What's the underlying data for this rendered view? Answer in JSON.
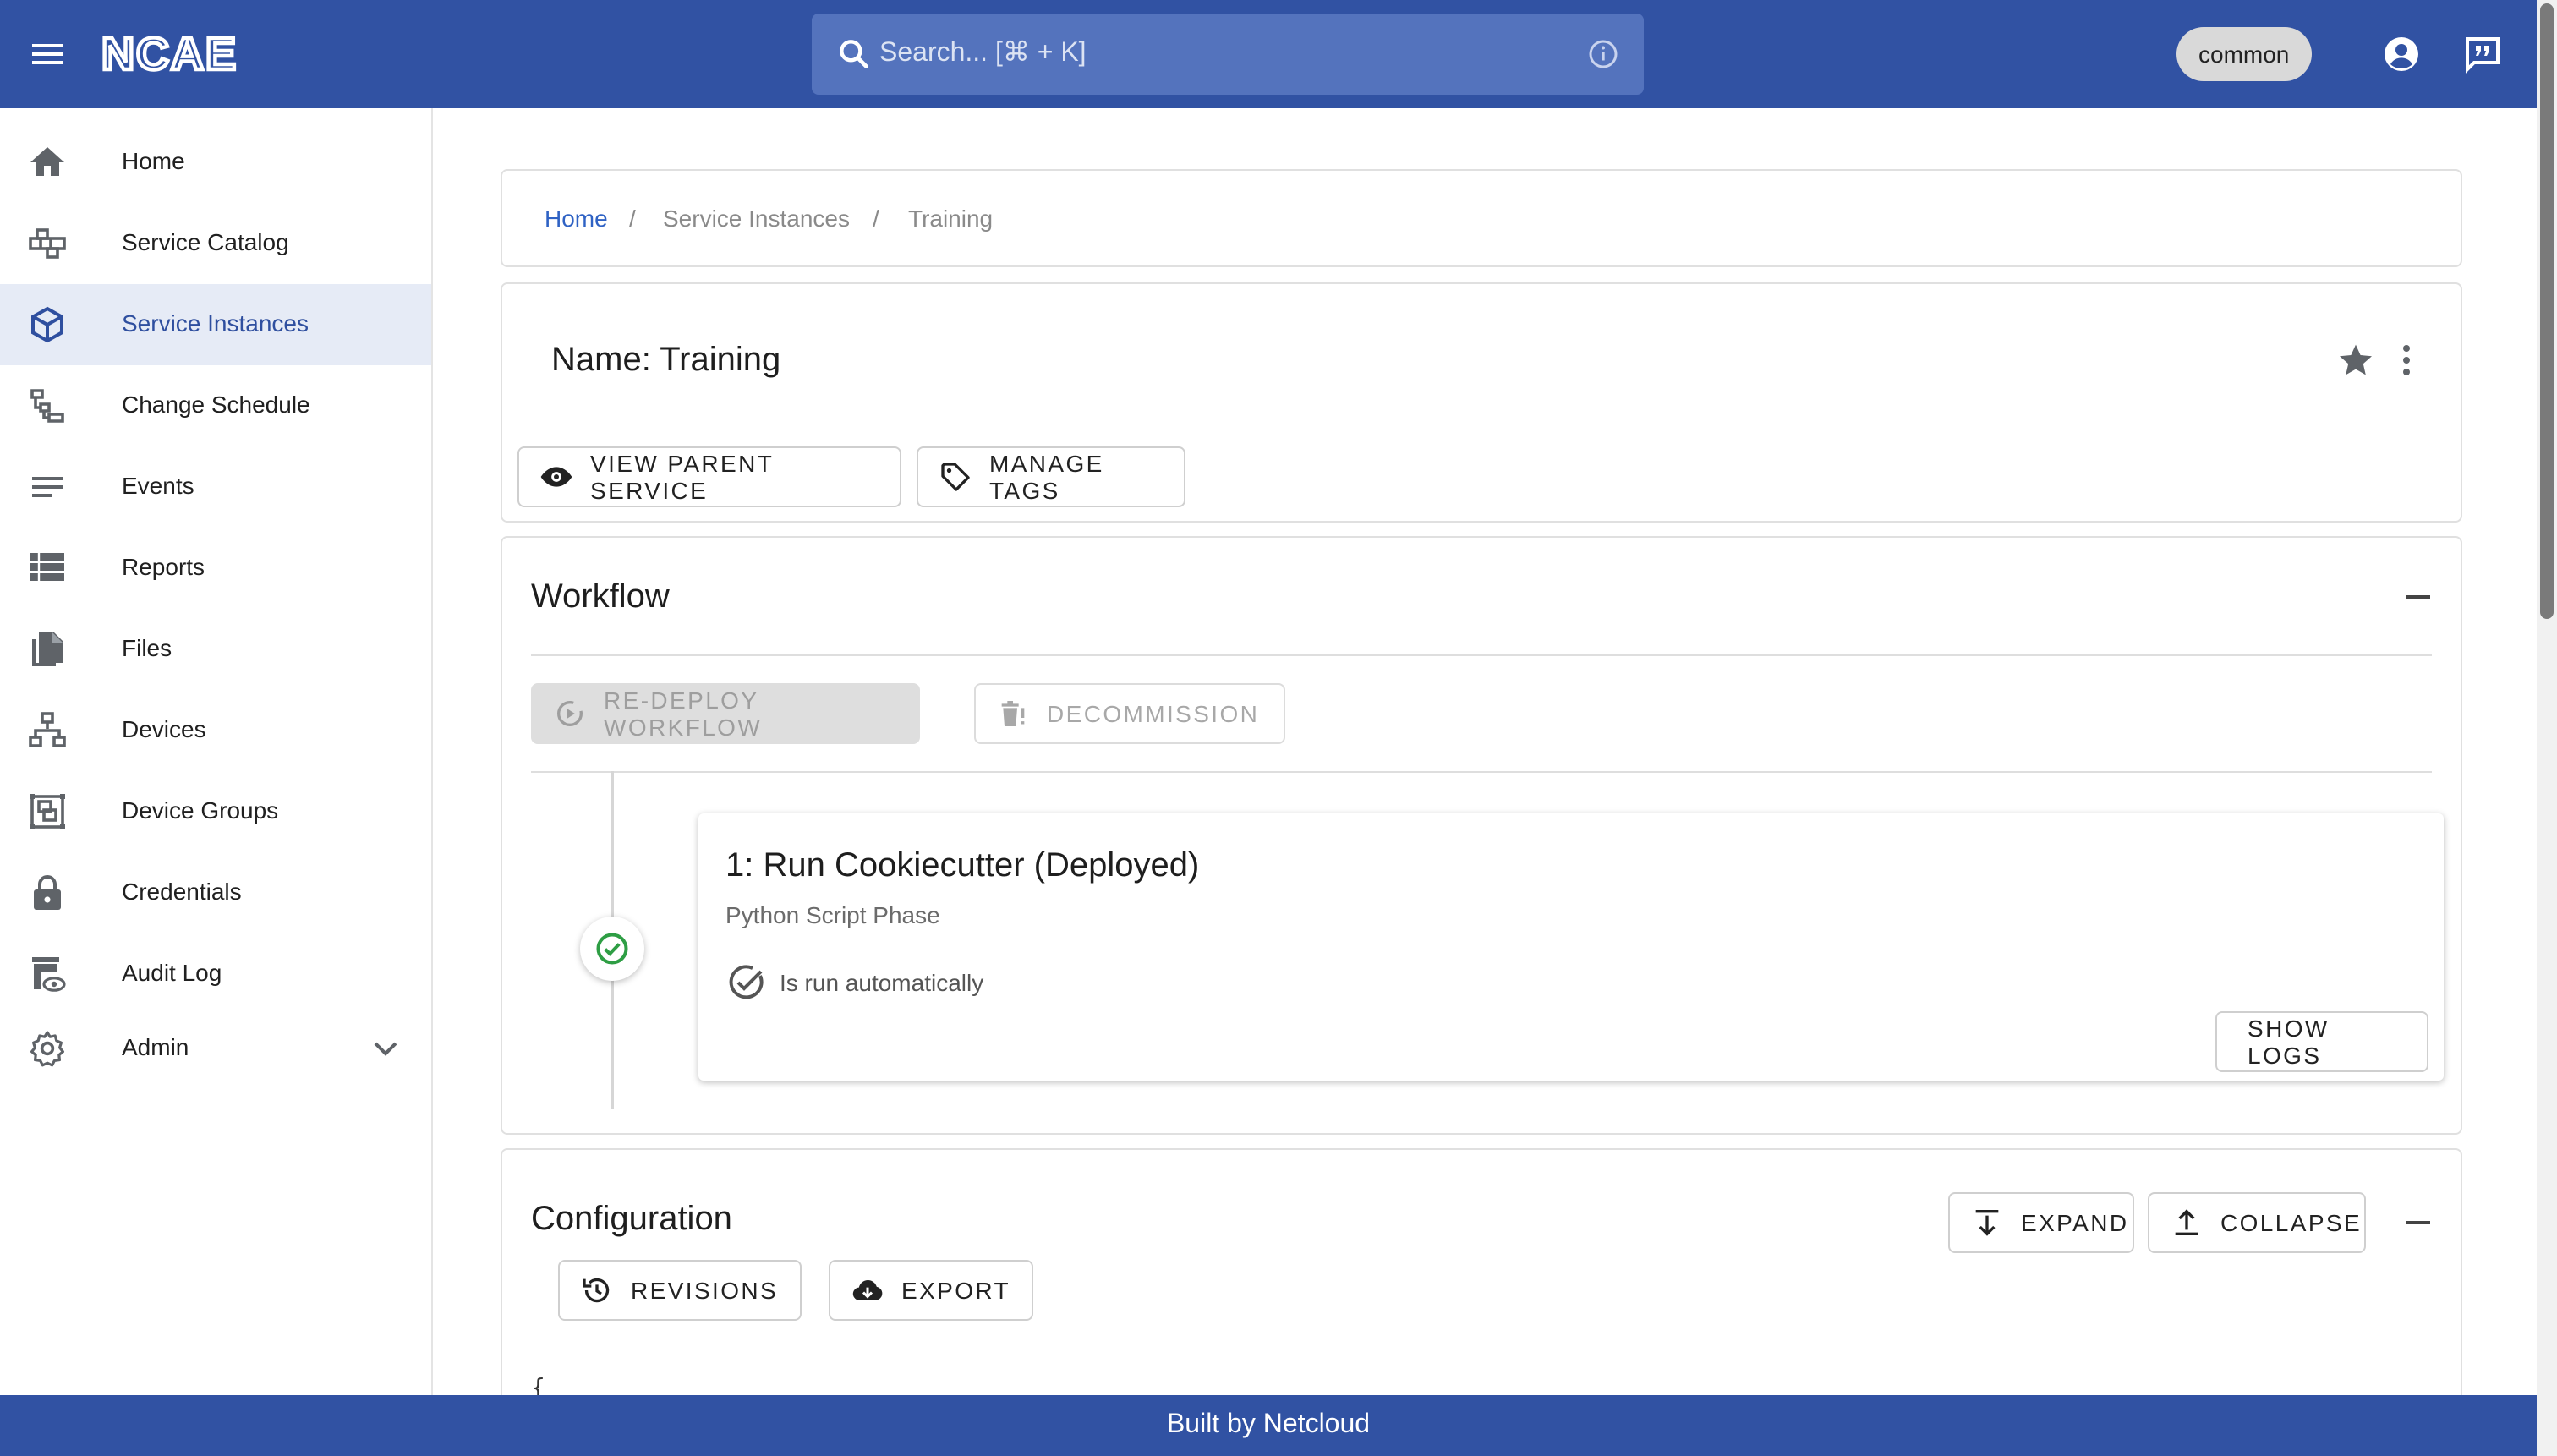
{
  "header": {
    "logo_text": "NCAE",
    "search_placeholder": "Search... [⌘ + K]",
    "tenant_chip": "common",
    "icons": [
      "menu-icon",
      "search-icon",
      "info-icon",
      "account-circle-icon",
      "feedback-icon"
    ]
  },
  "sidebar": {
    "items": [
      {
        "label": "Home",
        "icon": "home-icon"
      },
      {
        "label": "Service Catalog",
        "icon": "catalog-icon"
      },
      {
        "label": "Service Instances",
        "icon": "cube-icon",
        "active": true
      },
      {
        "label": "Change Schedule",
        "icon": "schedule-tree-icon"
      },
      {
        "label": "Events",
        "icon": "lines-icon"
      },
      {
        "label": "Reports",
        "icon": "reports-icon"
      },
      {
        "label": "Files",
        "icon": "files-icon"
      },
      {
        "label": "Devices",
        "icon": "devices-icon"
      },
      {
        "label": "Device Groups",
        "icon": "device-groups-icon"
      },
      {
        "label": "Credentials",
        "icon": "lock-icon"
      },
      {
        "label": "Audit Log",
        "icon": "audit-log-icon"
      },
      {
        "label": "Admin",
        "icon": "gear-icon",
        "expandable": true
      }
    ]
  },
  "breadcrumb": {
    "items": [
      "Home",
      "Service Instances",
      "Training"
    ],
    "separator": "/"
  },
  "instance": {
    "title": "Name: Training",
    "view_parent_label": "VIEW PARENT SERVICE",
    "manage_tags_label": "MANAGE TAGS"
  },
  "workflow": {
    "title": "Workflow",
    "redeploy_label": "RE-DEPLOY WORKFLOW",
    "decommission_label": "DECOMMISSION",
    "phase": {
      "title": "1: Run Cookiecutter (Deployed)",
      "subtitle": "Python Script Phase",
      "auto_text": "Is run automatically",
      "show_logs_label": "SHOW LOGS",
      "status": "deployed"
    }
  },
  "configuration": {
    "title": "Configuration",
    "expand_label": "EXPAND",
    "collapse_label": "COLLAPSE",
    "revisions_label": "REVISIONS",
    "export_label": "EXPORT",
    "code_start": "{"
  },
  "footer": {
    "text": "Built by Netcloud"
  },
  "colors": {
    "brand": "#3152a3",
    "active_bg": "#e6ebf6",
    "link": "#2f62c4",
    "success": "#2e9e44"
  }
}
